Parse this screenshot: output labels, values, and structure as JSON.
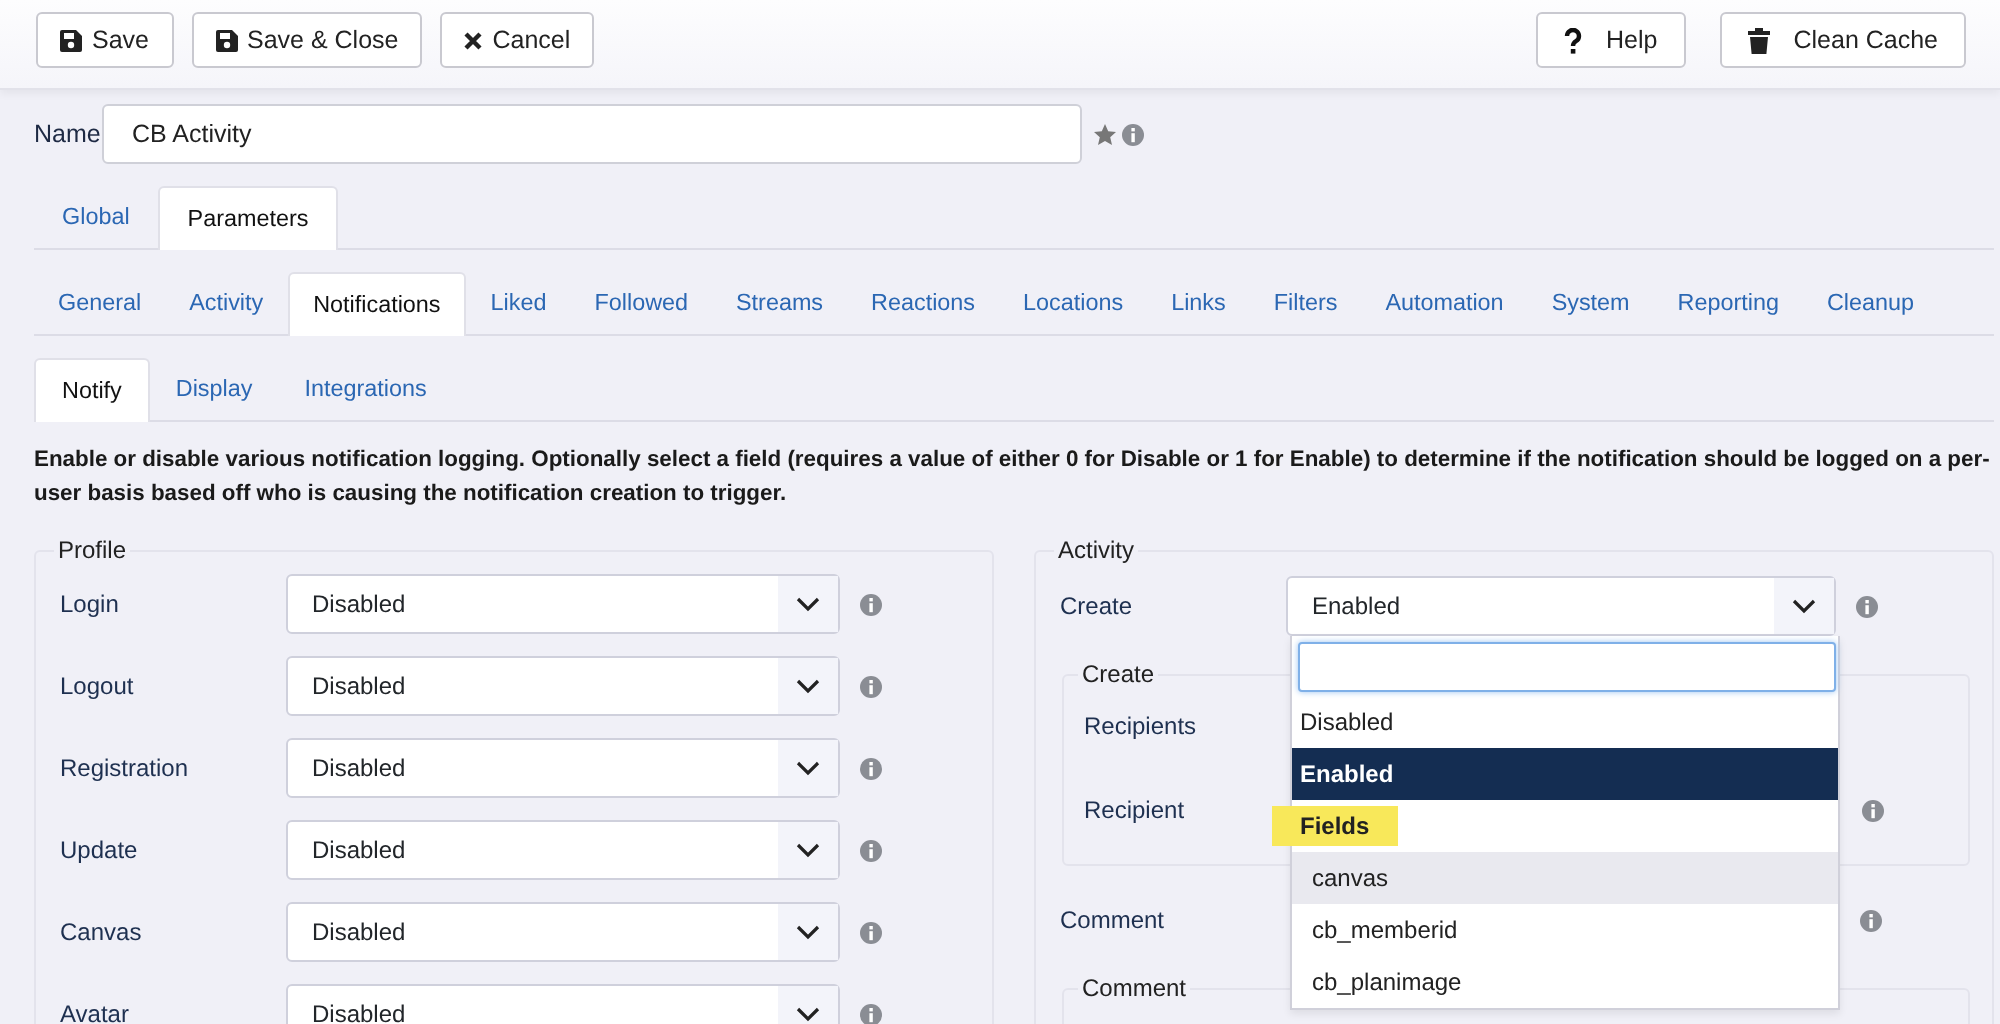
{
  "toolbar": {
    "buttons": [
      {
        "label": "Save",
        "kind": "save"
      },
      {
        "label": "Save & Close",
        "kind": "save"
      },
      {
        "label": "Cancel",
        "kind": "cancel"
      }
    ],
    "right_buttons": [
      {
        "label": "Help",
        "kind": "help"
      },
      {
        "label": "Clean Cache",
        "kind": "clear"
      }
    ]
  },
  "name_field": {
    "label": "Name",
    "value": "CB Activity"
  },
  "tabs": [
    {
      "label": "Global",
      "selected": false
    },
    {
      "label": "Parameters",
      "selected": true
    }
  ],
  "subtabs": [
    {
      "label": "General",
      "selected": false
    },
    {
      "label": "Activity",
      "selected": false
    },
    {
      "label": "Notifications",
      "selected": true
    },
    {
      "label": "Liked",
      "selected": false
    },
    {
      "label": "Followed",
      "selected": false
    },
    {
      "label": "Streams",
      "selected": false
    },
    {
      "label": "Reactions",
      "selected": false
    },
    {
      "label": "Locations",
      "selected": false
    },
    {
      "label": "Links",
      "selected": false
    },
    {
      "label": "Filters",
      "selected": false
    },
    {
      "label": "Automation",
      "selected": false
    },
    {
      "label": "System",
      "selected": false
    },
    {
      "label": "Reporting",
      "selected": false
    },
    {
      "label": "Cleanup",
      "selected": false
    }
  ],
  "notify_tabs": [
    {
      "label": "Notify",
      "selected": true
    },
    {
      "label": "Display",
      "selected": false
    },
    {
      "label": "Integrations",
      "selected": false
    }
  ],
  "description": "Enable or disable various notification logging. Optionally select a field (requires a value of either 0 for Disable or 1 for Enable) to determine if the notification should be logged on a per-user basis based off who is causing the notification creation to trigger.",
  "profile": {
    "legend": "Profile",
    "rows": [
      {
        "label": "Login",
        "value": "Disabled"
      },
      {
        "label": "Logout",
        "value": "Disabled"
      },
      {
        "label": "Registration",
        "value": "Disabled"
      },
      {
        "label": "Update",
        "value": "Disabled"
      },
      {
        "label": "Canvas",
        "value": "Disabled"
      },
      {
        "label": "Avatar",
        "value": "Disabled"
      }
    ]
  },
  "activity": {
    "legend": "Activity",
    "create": {
      "label": "Create",
      "value": "Enabled"
    },
    "create_group": {
      "legend": "Create",
      "rows": [
        {
          "label": "Recipients",
          "info": false
        },
        {
          "label": "Recipient",
          "info": true
        }
      ]
    },
    "comment": {
      "label": "Comment"
    },
    "comment_group": {
      "legend": "Comment"
    }
  },
  "dropdown": {
    "options": [
      {
        "kind": "option",
        "label": "Disabled",
        "selected": false,
        "hovered": false
      },
      {
        "kind": "option",
        "label": "Enabled",
        "selected": true,
        "hovered": false
      },
      {
        "kind": "group",
        "label": "Fields",
        "highlighted": true
      },
      {
        "kind": "option",
        "label": "canvas",
        "selected": false,
        "hovered": true
      },
      {
        "kind": "option",
        "label": "cb_memberid",
        "selected": false,
        "hovered": false
      },
      {
        "kind": "option",
        "label": "cb_planimage",
        "selected": false,
        "hovered": false
      }
    ]
  }
}
